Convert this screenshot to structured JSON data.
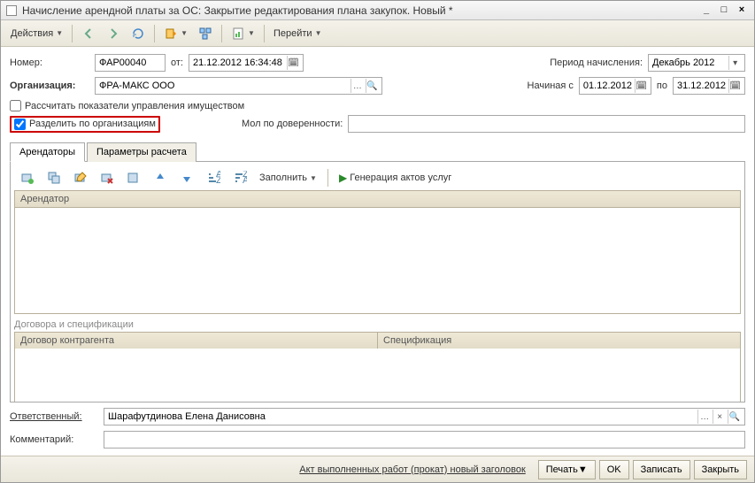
{
  "window": {
    "title": "Начисление арендной платы за ОС: Закрытие редактирования плана закупок. Новый *"
  },
  "toolbar": {
    "actions": "Действия",
    "goto": "Перейти"
  },
  "header": {
    "number_label": "Номер:",
    "number": "ФАР00040",
    "from_label": "от:",
    "date": "21.12.2012 16:34:48",
    "period_label": "Период начисления:",
    "period": "Декабрь 2012",
    "org_label": "Организация:",
    "org": "ФРА-МАКС ООО",
    "start_label": "Начиная с",
    "start_date": "01.12.2012",
    "to_label": "по",
    "end_date": "31.12.2012",
    "chk_calc": "Рассчитать показатели управления имуществом",
    "chk_split": "Разделить по организациям",
    "mol_label": "Мол по доверенности:",
    "mol_value": ""
  },
  "tabs": {
    "t1": "Арендаторы",
    "t2": "Параметры расчета"
  },
  "grid_toolbar": {
    "fill": "Заполнить",
    "gen": "Генерация актов услуг"
  },
  "grid1": {
    "col1": "Арендатор"
  },
  "section2": "Договора и спецификации",
  "grid2": {
    "col1": "Договор контрагента",
    "col2": "Спецификация"
  },
  "footer": {
    "resp_label": "Ответственный:",
    "resp": "Шарафутдинова Елена Данисовна",
    "comment_label": "Комментарий:",
    "comment": ""
  },
  "bottom": {
    "act": "Акт выполненных работ (прокат) новый заголовок",
    "print": "Печать",
    "ok": "OK",
    "save": "Записать",
    "close": "Закрыть"
  }
}
